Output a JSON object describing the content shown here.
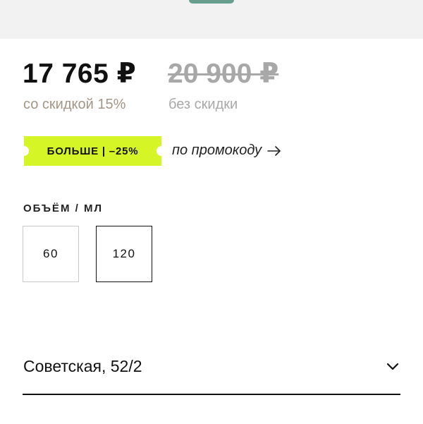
{
  "price": {
    "current": "17 765 ₽",
    "current_note": "со скидкой 15%",
    "old": "20 900 ₽",
    "old_note": "без скидки"
  },
  "promo": {
    "badge_text": "БОЛЬШЕ | –25%",
    "link_text": "по промокоду",
    "badge_color": "#d6f527"
  },
  "volume": {
    "label": "ОБЪЁМ / МЛ",
    "options": [
      "60",
      "120"
    ],
    "selected": "120"
  },
  "store": {
    "selected": "Советская, 52/2"
  },
  "icons": {
    "promo_arrow": "arrow-right-icon",
    "store_chevron": "chevron-down-icon"
  }
}
